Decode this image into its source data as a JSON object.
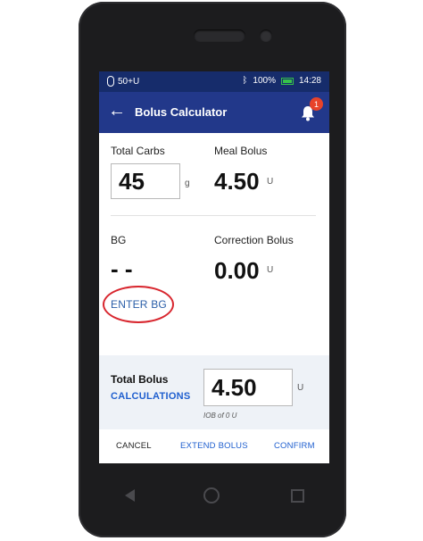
{
  "status_bar": {
    "pod_status": "50+U",
    "battery_percent": "100%",
    "time": "14:28",
    "icons": [
      "pod-icon",
      "bluetooth-icon",
      "battery-charging-icon"
    ]
  },
  "app_bar": {
    "title": "Bolus Calculator",
    "notification_count": "1"
  },
  "carbs": {
    "label": "Total Carbs",
    "value": "45",
    "unit": "g"
  },
  "meal_bolus": {
    "label": "Meal Bolus",
    "value": "4.50",
    "unit": "U"
  },
  "bg": {
    "label": "BG",
    "value": "- -",
    "enter_link": "ENTER BG"
  },
  "correction_bolus": {
    "label": "Correction Bolus",
    "value": "0.00",
    "unit": "U"
  },
  "total": {
    "label": "Total Bolus",
    "calculations_link": "CALCULATIONS",
    "value": "4.50",
    "unit": "U",
    "iob": "IOB of 0 U"
  },
  "footer": {
    "cancel": "CANCEL",
    "extend": "EXTEND BOLUS",
    "confirm": "CONFIRM"
  },
  "colors": {
    "status_bar_bg": "#162c6b",
    "app_bar_bg": "#22388a",
    "link_blue": "#2a5ea8",
    "badge_red": "#e8432a",
    "annotation_ring": "#d8262e"
  }
}
